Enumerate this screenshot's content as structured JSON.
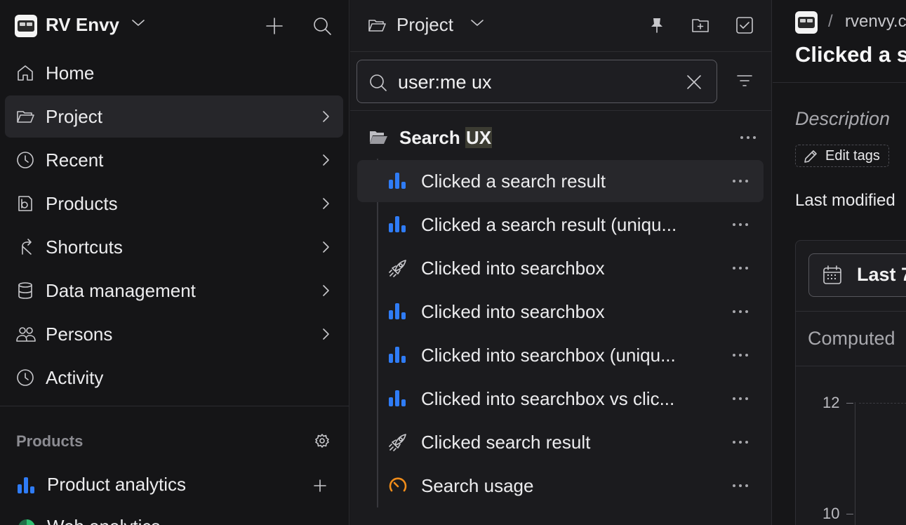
{
  "nav": {
    "project_name": "RV Envy",
    "items": [
      {
        "label": "Home",
        "icon": "home-icon"
      },
      {
        "label": "Project",
        "icon": "folder-open-icon"
      },
      {
        "label": "Recent",
        "icon": "clock-icon"
      },
      {
        "label": "Products",
        "icon": "products-icon"
      },
      {
        "label": "Shortcuts",
        "icon": "shortcut-arrow-icon"
      },
      {
        "label": "Data management",
        "icon": "database-icon"
      },
      {
        "label": "Persons",
        "icon": "people-icon"
      },
      {
        "label": "Activity",
        "icon": "clock-icon"
      }
    ],
    "section_title": "Products",
    "product_items": [
      {
        "label": "Product analytics",
        "icon": "bar-chart-icon"
      },
      {
        "label": "Web analytics",
        "icon": "pie-chart-icon"
      }
    ]
  },
  "list": {
    "header_title": "Project",
    "search": {
      "value": "user:me ux",
      "placeholder": ""
    },
    "folder": {
      "label_prefix": "Search ",
      "label_highlight": "UX"
    },
    "items": [
      {
        "label": "Clicked a search result",
        "icon": "bar-chart-icon"
      },
      {
        "label": "Clicked a search result (uniqu...",
        "icon": "bar-chart-icon"
      },
      {
        "label": "Clicked into searchbox",
        "icon": "rocket-icon"
      },
      {
        "label": "Clicked into searchbox",
        "icon": "bar-chart-icon"
      },
      {
        "label": "Clicked into searchbox (uniqu...",
        "icon": "bar-chart-icon"
      },
      {
        "label": "Clicked into searchbox vs clic...",
        "icon": "bar-chart-icon"
      },
      {
        "label": "Clicked search result",
        "icon": "rocket-icon"
      },
      {
        "label": "Search usage",
        "icon": "gauge-icon"
      }
    ]
  },
  "detail": {
    "breadcrumb_sep": "/",
    "breadcrumb_text": "rvenvy.c",
    "title": "Clicked a s",
    "description_placeholder": "Description",
    "edit_tags_label": "Edit tags",
    "last_modified": "Last modified",
    "date_filter_label": "Last 7",
    "computed_label": "Computed",
    "y_ticks": [
      "12",
      "10"
    ]
  },
  "colors": {
    "accent_blue": "#2f7cf6",
    "gauge_orange": "#f08c1a",
    "web_green": "#2fbf71"
  }
}
